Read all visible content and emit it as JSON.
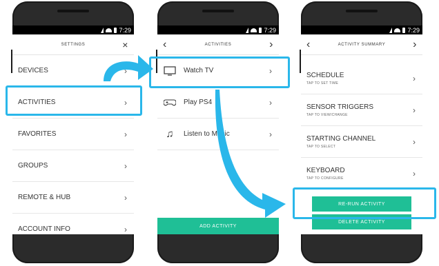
{
  "status": {
    "time": "7:29"
  },
  "screen1": {
    "title": "SETTINGS",
    "close_icon": "×",
    "items": [
      {
        "label": "DEVICES"
      },
      {
        "label": "ACTIVITIES"
      },
      {
        "label": "FAVORITES"
      },
      {
        "label": "GROUPS"
      },
      {
        "label": "REMOTE & HUB"
      },
      {
        "label": "ACCOUNT INFO"
      }
    ]
  },
  "screen2": {
    "title": "ACTIVITIES",
    "items": [
      {
        "label": "Watch TV",
        "icon": "tv-icon"
      },
      {
        "label": "Play PS4",
        "icon": "gamepad-icon"
      },
      {
        "label": "Listen to Music",
        "icon": "music-note-icon"
      }
    ],
    "add_button": "ADD ACTIVITY"
  },
  "screen3": {
    "title": "ACTIVITY SUMMARY",
    "items": [
      {
        "label": "SCHEDULE",
        "sub": "TAP TO SET TIME"
      },
      {
        "label": "SENSOR TRIGGERS",
        "sub": "TAP TO VIEW/CHANGE"
      },
      {
        "label": "STARTING CHANNEL",
        "sub": "TAP TO SELECT"
      },
      {
        "label": "KEYBOARD",
        "sub": "TAP TO CONFIGURE"
      }
    ],
    "rerun_button": "RE-RUN ACTIVITY",
    "delete_button": "DELETE ACTIVITY"
  },
  "colors": {
    "accent": "#1fbf96",
    "highlight": "#2ab7ea"
  }
}
